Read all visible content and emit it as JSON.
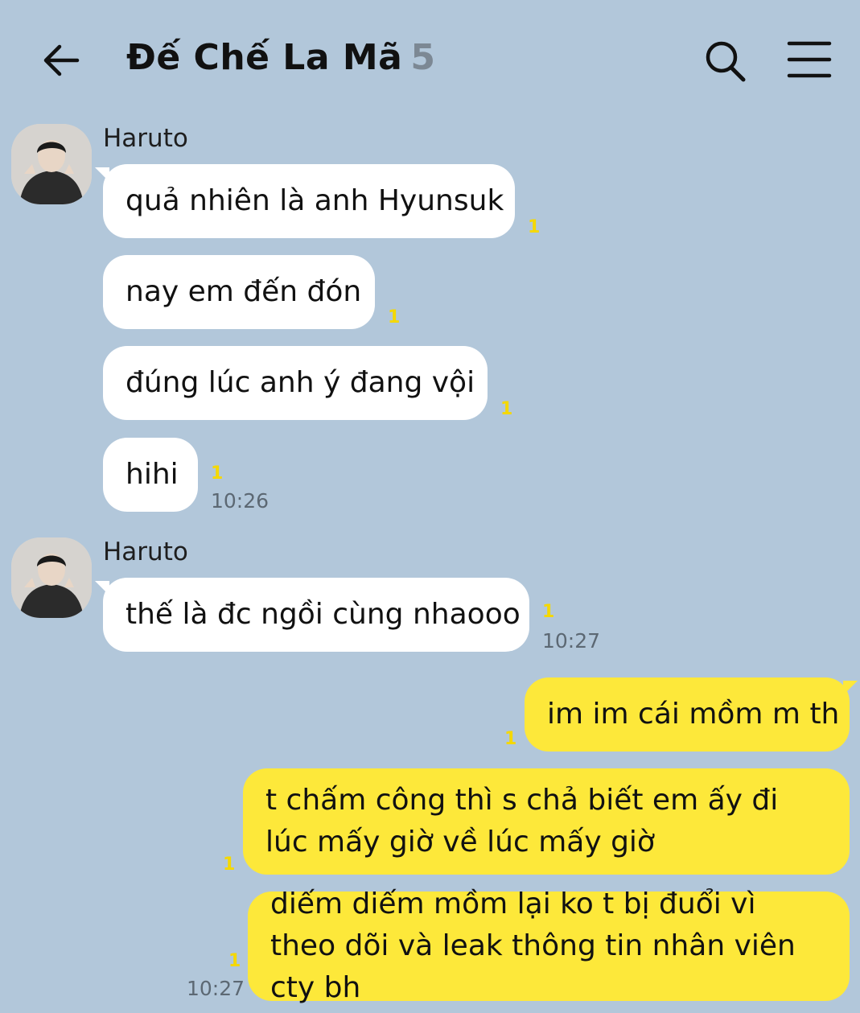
{
  "header": {
    "title": "Đế Chế La Mã",
    "member_count": "5",
    "back_icon": "arrow-left-icon",
    "search_icon": "search-icon",
    "menu_icon": "hamburger-menu-icon"
  },
  "colors": {
    "background": "#b2c7da",
    "incoming_bubble": "#ffffff",
    "outgoing_bubble": "#fde83a",
    "unread_count": "#f5d800"
  },
  "messages": [
    {
      "sender": "Haruto",
      "items": [
        {
          "text": "quả nhiên là anh Hyunsuk",
          "unread": "1"
        },
        {
          "text": "nay em đến đón",
          "unread": "1"
        },
        {
          "text": "đúng lúc anh ý đang vội",
          "unread": "1"
        },
        {
          "text": "hihi",
          "unread": "1",
          "time": "10:26"
        }
      ]
    },
    {
      "sender": "Haruto",
      "items": [
        {
          "text": "thế là đc ngồi cùng nhaooo",
          "unread": "1",
          "time": "10:27"
        }
      ]
    },
    {
      "sender": "me",
      "items": [
        {
          "text": "im im cái mồm m th",
          "unread": "1"
        },
        {
          "text": "t chấm công thì s chả biết em ấy đi lúc mấy giờ về lúc mấy giờ",
          "unread": "1"
        },
        {
          "text": "diếm diếm mồm lại ko t bị đuổi vì theo dõi và leak thông tin nhân viên cty bh",
          "unread": "1",
          "time": "10:27"
        }
      ]
    }
  ]
}
